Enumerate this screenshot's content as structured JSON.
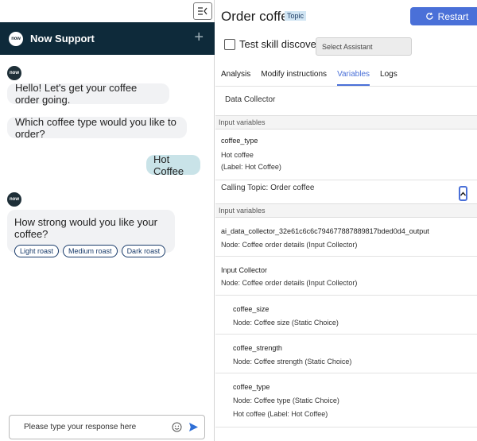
{
  "chat": {
    "header_title": "Now Support",
    "logo_text": "now",
    "messages": {
      "greeting": "Hello! Let's get your coffee order going.",
      "question_type": "Which coffee type would you like to order?",
      "user_reply": "Hot Coffee",
      "question_strength": "How strong would you like your coffee?"
    },
    "options": [
      "Light roast",
      "Medium roast",
      "Dark roast"
    ],
    "input_placeholder": "Please type your response here"
  },
  "topic": {
    "title": "Order coffee",
    "badge": "Topic",
    "restart_label": "Restart",
    "test_skill_label": "Test skill discovery",
    "select_assistant_placeholder": "Select Assistant",
    "tabs": [
      "Analysis",
      "Modify instructions",
      "Variables",
      "Logs"
    ],
    "active_tab": "Variables"
  },
  "variables": {
    "collector_title": "Data Collector",
    "section1_header": "Input variables",
    "var1_name": "coffee_type",
    "var1_value": "Hot coffee",
    "var1_label": "(Label: Hot Coffee)",
    "calling_topic": "Calling Topic:  Order coffee",
    "section2_header": "Input variables",
    "output_var_name": "ai_data_collector_32e61c6c6c794677887889817bded0d4_output",
    "output_var_node": "Node: Coffee order details (Input Collector)",
    "input_collector_name": "Input Collector",
    "input_collector_node": "Node: Coffee order details (Input Collector)",
    "size_name": "coffee_size",
    "size_node": "Node: Coffee size (Static Choice)",
    "strength_name": "coffee_strength",
    "strength_node": "Node: Coffee strength (Static Choice)",
    "type_name": "coffee_type",
    "type_node": "Node: Coffee type (Static Choice)",
    "type_value": "Hot coffee (Label: Hot Coffee)"
  },
  "colors": {
    "header_bg": "#0e2a3a",
    "accent": "#4a70d8",
    "user_bubble": "#c9e3e8",
    "bot_bubble": "#f1f2f4"
  }
}
